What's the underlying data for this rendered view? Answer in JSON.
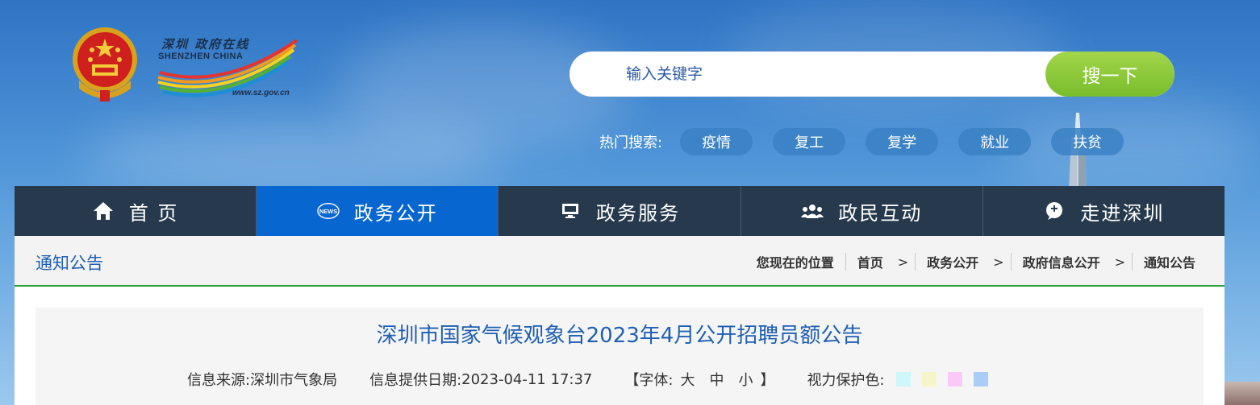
{
  "logo": {
    "cn": "深圳 政府在线",
    "en": "SHENZHEN CHINA",
    "url": "www.sz.gov.cn"
  },
  "search": {
    "placeholder": "输入关键字",
    "button_label": "搜一下"
  },
  "hot_search": {
    "label": "热门搜索:",
    "tags": [
      "疫情",
      "复工",
      "复学",
      "就业",
      "扶贫"
    ]
  },
  "nav": {
    "items": [
      {
        "label": "首 页",
        "icon": "home-icon"
      },
      {
        "label": "政务公开",
        "icon": "news-icon",
        "active": true
      },
      {
        "label": "政务服务",
        "icon": "monitor-icon"
      },
      {
        "label": "政民互动",
        "icon": "users-icon"
      },
      {
        "label": "走进深圳",
        "icon": "chat-icon"
      }
    ]
  },
  "breadcrumb": {
    "section_title": "通知公告",
    "location_label": "您现在的位置",
    "items": [
      "首页",
      "政务公开",
      "政府信息公开",
      "通知公告"
    ],
    "separator": ">"
  },
  "article": {
    "title": "深圳市国家气候观象台2023年4月公开招聘员额公告",
    "source_label": "信息来源:",
    "source_value": "深圳市气象局",
    "date_label": "信息提供日期:",
    "date_value": "2023-04-11 17:37",
    "font_open": "【字体:",
    "font_large": "大",
    "font_medium": "中",
    "font_small": "小",
    "font_close": "】",
    "eye_label": "视力保护色:",
    "eye_colors": [
      "#cdf7f9",
      "#f4f6c9",
      "#fbc9f8",
      "#a9cdf5"
    ]
  },
  "colors": {
    "nav_bg": "#273a4d",
    "nav_active": "#0866d1",
    "search_button": "#8cc93b",
    "title_blue": "#1f5fb4",
    "divider_green": "#2e9e3e"
  }
}
